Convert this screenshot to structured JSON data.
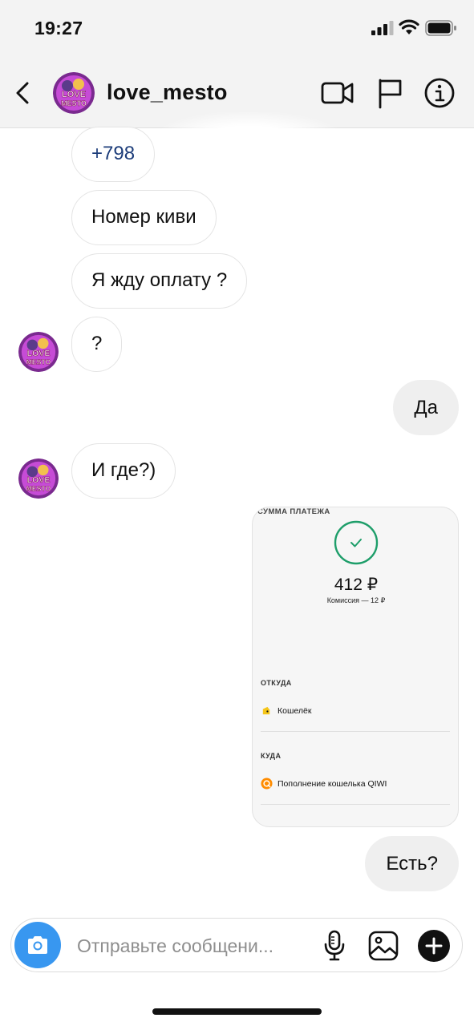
{
  "status_bar": {
    "time": "19:27"
  },
  "header": {
    "username": "love_mesto",
    "avatar_text_top": "LOVE",
    "avatar_text_bottom": "MESTO"
  },
  "messages": [
    {
      "sender": "other",
      "text": "+798"
    },
    {
      "sender": "other",
      "text": "Номер киви"
    },
    {
      "sender": "other",
      "text": "Я жду оплату ?"
    },
    {
      "sender": "other",
      "text": "?"
    },
    {
      "sender": "me",
      "text": "Да"
    },
    {
      "sender": "other",
      "text": "И где?)"
    },
    {
      "sender": "me",
      "text": "Есть?"
    }
  ],
  "payment_card": {
    "label": "СУММА ПЛАТЕЖА",
    "amount": "412 ₽",
    "fee": "Комиссия — 12 ₽",
    "from_label": "ОТКУДА",
    "from_value": "Кошелёк",
    "to_label": "КУДА",
    "to_value": "Пополнение кошелька QIWI"
  },
  "composer": {
    "placeholder": "Отправьте сообщени..."
  },
  "colors": {
    "accent": "#3897f0",
    "check_green": "#1e9e6a",
    "qiwi_orange": "#ff8c00"
  }
}
